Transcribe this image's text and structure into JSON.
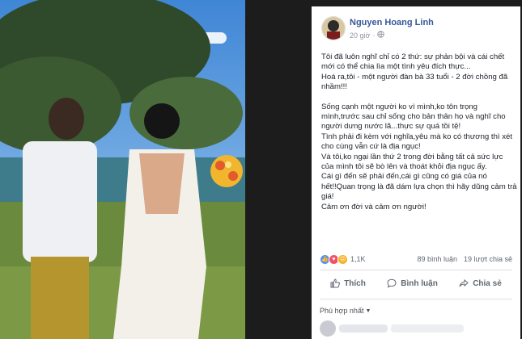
{
  "post": {
    "author": "Nguyen Hoang Linh",
    "time": "20 giờ",
    "paragraphs": [
      "Tôi đã luôn nghĩ chỉ có 2 thứ: sự phản bội và cái chết mới có thể chia lìa một tình yêu đích thực...\nHoá ra,tôi - một người đàn bà 33 tuổi - 2 đời chồng đã nhầm!!!",
      "Sống cạnh một người ko vì mình,ko tôn trọng mình,trước sau chỉ sống cho bản thân họ và nghĩ cho người dưng nước lã...thực sự quá tồi tệ!\nTình phải đi kèm với nghĩa,yêu mà ko có thương thì xét cho cùng vẫn cứ là địa ngục!\nVà tôi,ko ngại lần thứ 2 trong đời bằng tất cả sức lực của mình tôi sẽ bò lên và thoát khỏi địa ngục ấy.\nCái gì đến sẽ phải đến,cái gì cũng có giá của nó hết!!Quan trọng là đã dám lựa chọn thì hãy dũng cảm trả giá!\nCảm ơn đời và cảm ơn người!"
    ],
    "reaction_count": "1,1K",
    "comments": "89 bình luận",
    "shares": "19 lượt chia sẻ",
    "colors": {
      "author": "#365899",
      "like": "#5890ff",
      "love": "#f25268",
      "sad": "#f7b125"
    }
  },
  "actions": {
    "like": "Thích",
    "comment": "Bình luận",
    "share": "Chia sẻ"
  },
  "sort_label": "Phù hợp nhất"
}
